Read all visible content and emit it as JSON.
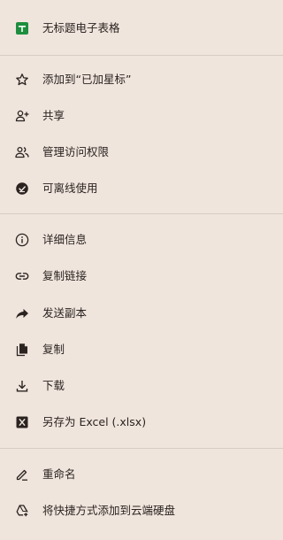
{
  "header": {
    "file_name": "无标题电子表格",
    "file_icon": "google-sheets-icon",
    "file_icon_color": "#1e8e3e"
  },
  "menu": {
    "star_label": "添加到“已加星标”",
    "share_label": "共享",
    "manage_access_label": "管理访问权限",
    "offline_label": "可离线使用",
    "details_label": "详细信息",
    "copy_link_label": "复制链接",
    "send_copy_label": "发送副本",
    "duplicate_label": "复制",
    "download_label": "下载",
    "save_as_excel_label": "另存为 Excel (.xlsx)",
    "rename_label": "重命名",
    "add_shortcut_label": "将快捷方式添加到云端硬盘"
  },
  "theme": {
    "background": "#f0e5dd",
    "text": "#2a2320",
    "divider": "#d9cbc1"
  }
}
